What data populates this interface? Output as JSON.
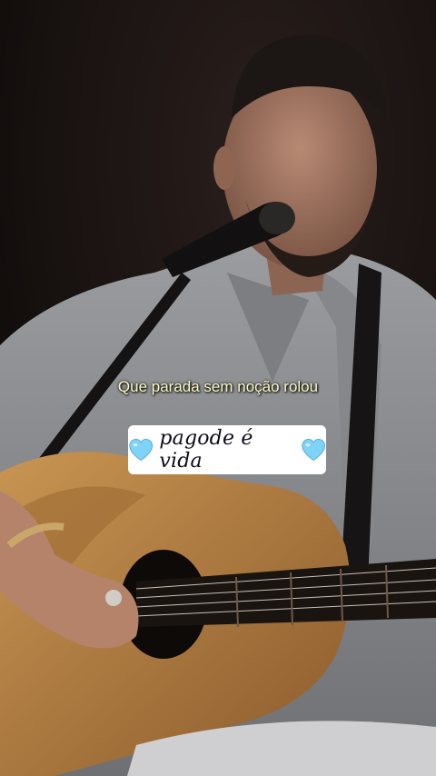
{
  "caption": "Que parada sem noção rolou",
  "sticker": {
    "left_icon": "light-blue-heart",
    "text": "pagode é vida",
    "right_icon": "light-blue-heart",
    "heart_color": "#7fd3f7"
  }
}
